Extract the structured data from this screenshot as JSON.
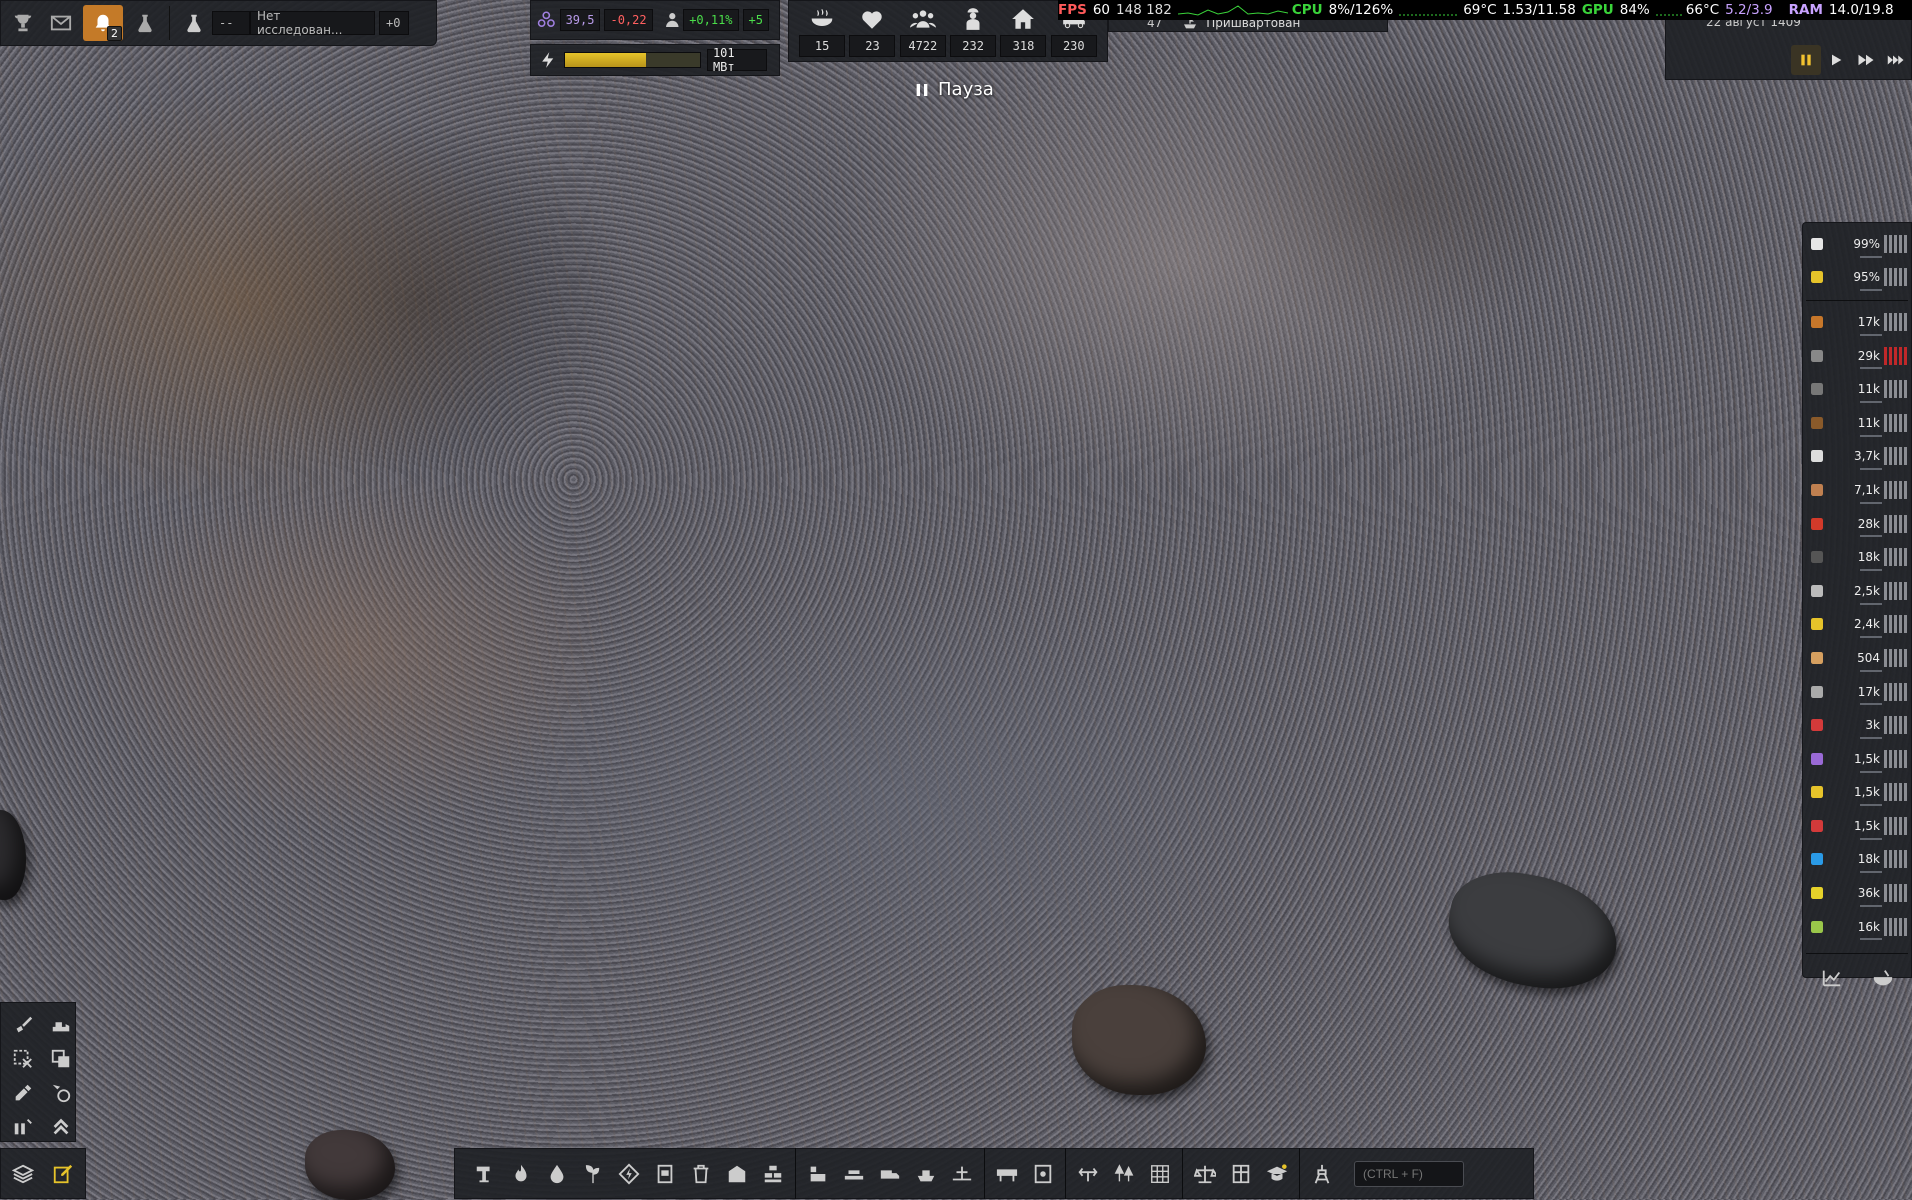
{
  "top_left": {
    "notification_count": "2",
    "research_dash": "--",
    "research_label": "Нет исследован...",
    "research_delta": "+0"
  },
  "stats": {
    "unity_value": "39,5",
    "unity_delta": "-0,22",
    "pop_growth": "+0,11%",
    "pop_delta": "+5"
  },
  "power": {
    "label": "101 МВт",
    "fill": 0.6
  },
  "counters": [
    {
      "icon": "food-icon",
      "value": "15"
    },
    {
      "icon": "health-icon",
      "value": "23"
    },
    {
      "icon": "population-icon",
      "value": "4722"
    },
    {
      "icon": "workers-icon",
      "value": "232"
    },
    {
      "icon": "housing-icon",
      "value": "318"
    },
    {
      "icon": "vehicles-icon",
      "value": "230"
    }
  ],
  "perf": {
    "fps_label": "FPS",
    "fps_value": "60",
    "frametime": "148 182",
    "cpu_label": "CPU",
    "cpu_value": "8%/126%",
    "cpu_temp": "69°C",
    "cpu_clock": "1.53/11.58",
    "gpu_label": "GPU",
    "gpu_value": "84%",
    "gpu_temp": "66°C",
    "gpu_mem": "5.2/3.9",
    "ram_label": "RAM",
    "ram_value": "14.0/19.8"
  },
  "status": {
    "ships": "47",
    "docked": "Пришвартован"
  },
  "date": "22 август 1409",
  "pause_label": "Пауза",
  "colors": {
    "accent": "#c47a28",
    "perf_green": "#3ad43a",
    "perf_red": "#ff5a5a",
    "ram_purple": "#c8a2ff"
  },
  "resources": {
    "top": [
      {
        "icon": "maintenance-icon",
        "value": "99%",
        "color": "#e6e6e6"
      },
      {
        "icon": "maintenance2-icon",
        "value": "95%",
        "color": "#e6c32a"
      }
    ],
    "items": [
      {
        "icon": "barrel-icon",
        "value": "17k",
        "color": "#c7772a"
      },
      {
        "icon": "rubble-icon",
        "value": "29k",
        "color": "#888",
        "warn": true
      },
      {
        "icon": "slag-icon",
        "value": "11k",
        "color": "#777"
      },
      {
        "icon": "wood-icon",
        "value": "11k",
        "color": "#8a5a2a"
      },
      {
        "icon": "worker-icon",
        "value": "3,7k",
        "color": "#ddd"
      },
      {
        "icon": "planks-icon",
        "value": "7,1k",
        "color": "#c08050"
      },
      {
        "icon": "fuel-icon",
        "value": "28k",
        "color": "#d33a2a"
      },
      {
        "icon": "steel-icon",
        "value": "18k",
        "color": "#555"
      },
      {
        "icon": "concrete-icon",
        "value": "2,5k",
        "color": "#bbb"
      },
      {
        "icon": "construction-icon",
        "value": "2,4k",
        "color": "#e6c32a"
      },
      {
        "icon": "food-crate-icon",
        "value": "504",
        "color": "#d6a060"
      },
      {
        "icon": "plate-icon",
        "value": "17k",
        "color": "#aaa"
      },
      {
        "icon": "red-part-icon",
        "value": "3k",
        "color": "#d33a3a"
      },
      {
        "icon": "purple-part-icon",
        "value": "1,5k",
        "color": "#9a6ad6"
      },
      {
        "icon": "yellow-part-icon",
        "value": "1,5k",
        "color": "#e6c32a"
      },
      {
        "icon": "red-tool-icon",
        "value": "1,5k",
        "color": "#d33a3a"
      },
      {
        "icon": "water-icon",
        "value": "18k",
        "color": "#2a9ae6"
      },
      {
        "icon": "battery-icon",
        "value": "36k",
        "color": "#e6d22a"
      },
      {
        "icon": "chemical-icon",
        "value": "16k",
        "color": "#9ac64a"
      }
    ]
  },
  "search": {
    "placeholder": "(CTRL + F)"
  }
}
